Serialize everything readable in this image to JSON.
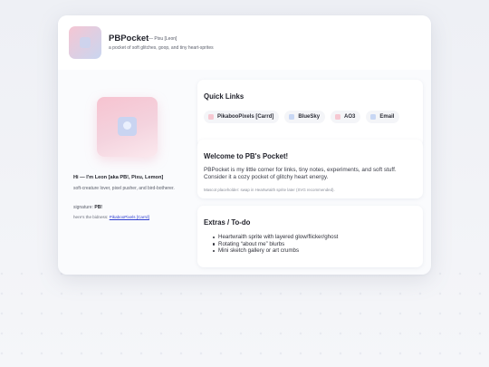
{
  "header": {
    "site_name": "PBPocket",
    "alias": "— Pixu [Leon]",
    "tagline": "a pocket of soft glitches, goop, and tiny heart-sprites"
  },
  "profile": {
    "greeting": "Hi — I'm Leon [aka PB!, Pixu, Lemon]",
    "bio": "soft-creature lover, pixel pusher, and bird-botherer.",
    "signature_label": "signature:",
    "signature_value": "PB!",
    "bidness_text": "here's the bidness:",
    "bidness_link": "PikabooPixels [Carrd]"
  },
  "quick_links": {
    "title": "Quick Links",
    "items": [
      {
        "label": "PikabooPixels [Carrd]",
        "color": "#f6c8d2"
      },
      {
        "label": "BlueSky",
        "color": "#c8d7f4"
      },
      {
        "label": "AO3",
        "color": "#f6c8d2"
      },
      {
        "label": "Email",
        "color": "#c8d7f4"
      }
    ]
  },
  "welcome": {
    "title": "Welcome to PB's Pocket!",
    "text": "PBPocket is my little corner for links, tiny notes, experiments, and soft stuff. Consider it a cozy pocket of glitchy heart energy.",
    "note": "Mascot placeholder: swap in Heartwraith sprite later (SVG recommended)."
  },
  "extras": {
    "title": "Extras / To-do",
    "items": [
      "Heartwraith sprite with layered glow/flicker/ghost",
      "Rotating “about me” blurbs",
      "Mini sketch gallery or art crumbs"
    ]
  }
}
